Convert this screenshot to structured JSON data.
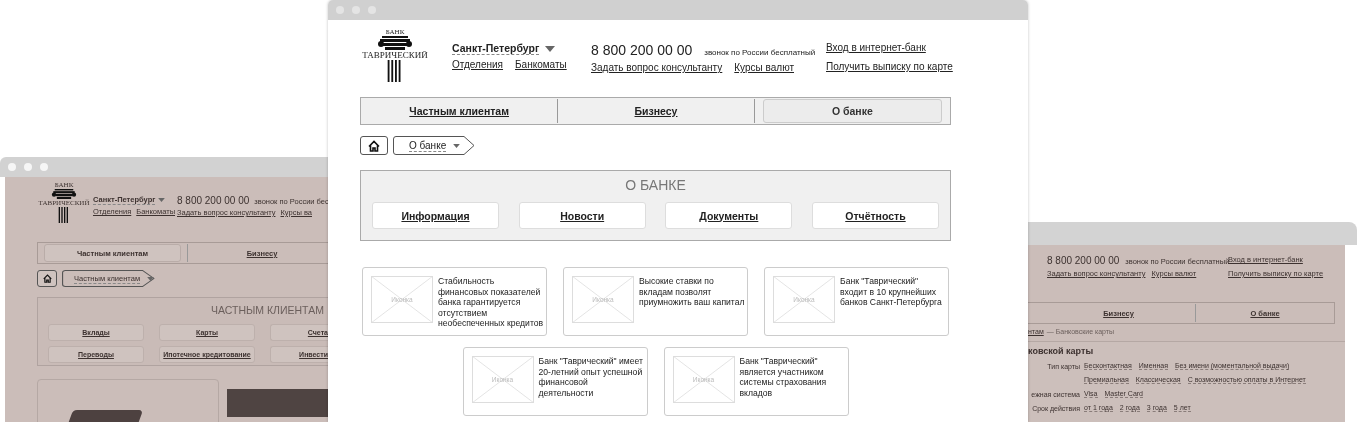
{
  "back_left_window": {
    "logo": {
      "top": "БАНК",
      "name": "ТАВРИЧЕСКИЙ"
    },
    "city": "Санкт-Петербург",
    "links": [
      "Отделения",
      "Банкоматы"
    ],
    "phone": "8 800 200 00 00",
    "phone_note": "звонок по России бес",
    "contact_links": [
      "Задать вопрос консультанту",
      "Курсы ва"
    ],
    "nav_tabs": [
      {
        "label": "Частным клиентам",
        "selected": true
      },
      {
        "label": "Бизнесу",
        "selected": false
      }
    ],
    "breadcrumb": "Частным клиентам",
    "section": {
      "title": "ЧАСТНЫМ КЛИЕНТАМ",
      "buttons": [
        "Вклады",
        "Карты",
        "Счета",
        "Переводы",
        "Ипотечное кредитование",
        "Инвести"
      ]
    }
  },
  "main_window": {
    "logo": {
      "top": "БАНК",
      "name": "ТАВРИЧЕСКИЙ"
    },
    "city": "Санкт-Петербург",
    "links": [
      "Отделения",
      "Банкоматы"
    ],
    "phone": "8 800 200 00 00",
    "phone_note": "звонок по России бесплатный",
    "contact_links": [
      "Задать вопрос консультанту",
      "Курсы валют"
    ],
    "account_links": [
      "Вход в интернет-банк",
      "Получить выписку по карте"
    ],
    "nav_tabs": [
      {
        "label": "Частным клиентам",
        "selected": false
      },
      {
        "label": "Бизнесу",
        "selected": false
      },
      {
        "label": "О банке",
        "selected": true
      }
    ],
    "breadcrumb": "О банке",
    "section": {
      "title": "О БАНКЕ",
      "buttons": [
        "Информация",
        "Новости",
        "Документы",
        "Отчётность"
      ]
    },
    "cards": [
      {
        "image_label": "Иконка",
        "text": "Стабильность финансовых показателей банка гарантируется отсутствием необеспеченных кредитов"
      },
      {
        "image_label": "Иконка",
        "text": "Высокие ставки по вкладам позволят приумножить ваш капитал"
      },
      {
        "image_label": "Иконка",
        "text": "Банк \"Таврический\" входит в 10 крупнейших банков Санкт-Петербурга"
      },
      {
        "image_label": "Иконка",
        "text": "Банк \"Таврический\" имеет 20-летний опыт успешной финансовой деятельности"
      },
      {
        "image_label": "Иконка",
        "text": "Банк \"Таврический\" является участником системы страхования вкладов"
      }
    ]
  },
  "back_right_window": {
    "phone": "8 800 200 00 00",
    "phone_note": "звонок по России бесплатный",
    "contact_links": [
      "Задать вопрос консультанту",
      "Курсы валют"
    ],
    "account_links": [
      "Вход в интернет-банк",
      "Получить выписку по карте"
    ],
    "nav_tabs": [
      {
        "label": "Бизнесу",
        "selected": false
      },
      {
        "label": "О банке",
        "selected": false
      }
    ],
    "breadcrumb": {
      "link": "нтам",
      "current": "— Банковские карты"
    },
    "filter": {
      "title": "ковской карты",
      "rows": [
        {
          "label": "Тип карты",
          "options": [
            "Бесконтактная",
            "Именная",
            "Без имени (моментальной выдачи)"
          ]
        },
        {
          "options": [
            "Премиальная",
            "Классическая",
            "С возможностью оплаты в Интернет"
          ]
        },
        {
          "label": "ежная система",
          "options": [
            "Visa",
            "Master Card"
          ]
        },
        {
          "label": "Срок действия",
          "options": [
            "от 1 года",
            "2 года",
            "3 года",
            "5 лет"
          ]
        }
      ]
    }
  }
}
